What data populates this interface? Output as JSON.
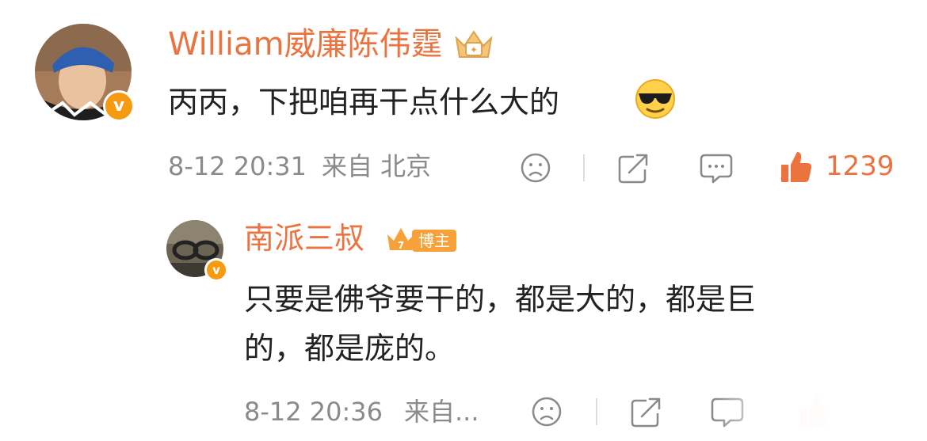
{
  "comment": {
    "username": "William威廉陈伟霆",
    "text": "丙丙，下把咱再干点什么大的",
    "time": "8-12 20:31",
    "location": "来自 北京",
    "like_count": "1239",
    "emoji": "cool-sunglasses-emoji"
  },
  "reply": {
    "username": "南派三叔",
    "badge": "博主",
    "text_line1": "只要是佛爷要干的，都是大的，都是巨",
    "text_line2": "的，都是庞的。",
    "time": "8-12 20:36",
    "location": "来自..."
  },
  "colors": {
    "accent": "#eb7340",
    "text": "#222222",
    "meta": "#8a8a8a",
    "verified": "#f59a11"
  }
}
